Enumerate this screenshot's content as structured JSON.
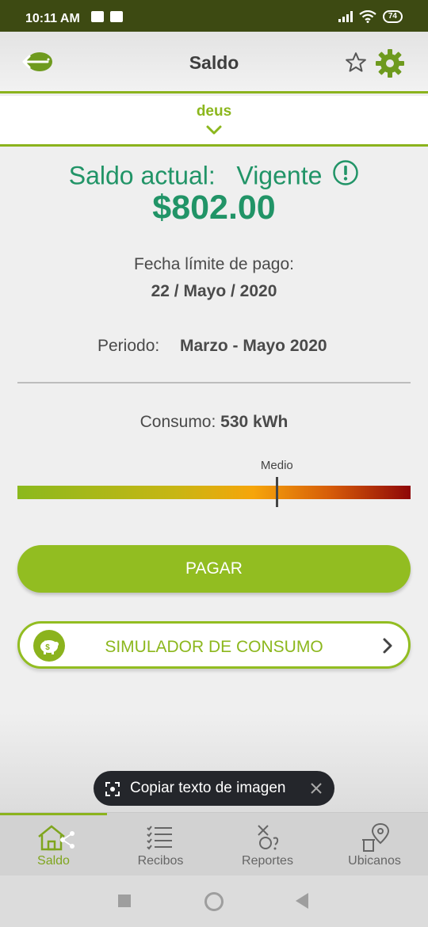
{
  "status_bar": {
    "time": "10:11 AM",
    "battery": "74"
  },
  "header": {
    "title": "Saldo"
  },
  "account": {
    "name": "deus"
  },
  "balance": {
    "label": "Saldo actual:",
    "status": "Vigente",
    "amount": "$802.00"
  },
  "due": {
    "label": "Fecha límite de pago:",
    "date": "22 / Mayo / 2020"
  },
  "period": {
    "label": "Periodo:",
    "value": "Marzo - Mayo 2020"
  },
  "consumption": {
    "label": "Consumo:",
    "value": "530 kWh",
    "gauge_label": "Medio",
    "gauge_level": 0.66
  },
  "actions": {
    "pay_label": "PAGAR",
    "simulator_label": "SIMULADOR DE CONSUMO"
  },
  "toast": {
    "text": "Copiar texto de imagen"
  },
  "bottom_nav": {
    "items": [
      {
        "label": "Saldo",
        "icon": "home-icon"
      },
      {
        "label": "Recibos",
        "icon": "checklist-icon"
      },
      {
        "label": "Reportes",
        "icon": "report-icon"
      },
      {
        "label": "Ubicanos",
        "icon": "location-icon"
      }
    ]
  },
  "colors": {
    "brand_green": "#8bb31d",
    "balance_green": "#219467",
    "status_bar": "#3d4a12"
  }
}
